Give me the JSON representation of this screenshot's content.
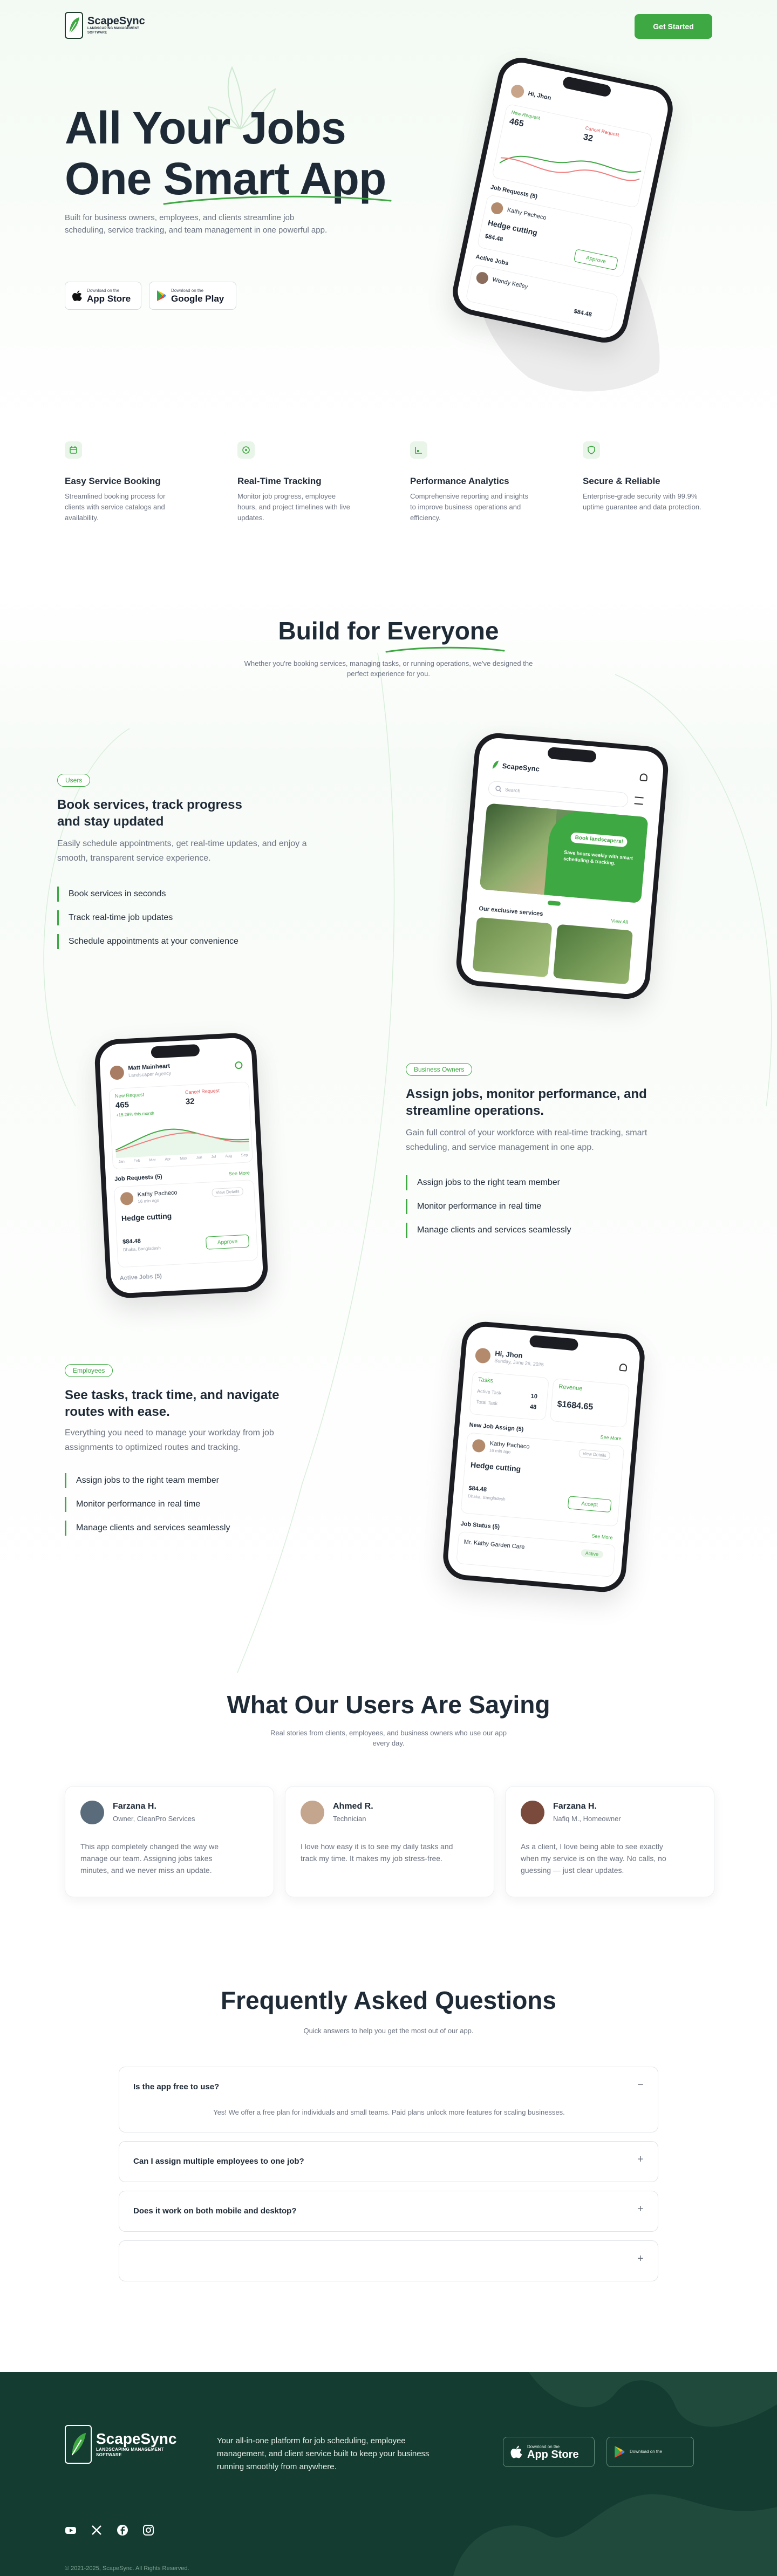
{
  "header": {
    "brand": "ScapeSync",
    "brand_tag": "LANDSCAPING MANAGEMENT SOFTWARE",
    "cta": "Get Started"
  },
  "hero": {
    "title_line1": "All Your Jobs",
    "title_line2_a": "One ",
    "title_line2_b": "Smart App",
    "subtitle": "Built for business owners, employees, and clients streamline job scheduling, service tracking, and team management in one powerful app.",
    "app_store_small": "Download on the",
    "app_store_big": "App Store",
    "google_small": "Download on the",
    "google_big": "Google Play"
  },
  "hero_phone": {
    "greeting": "Hi, Jhon",
    "new_request_label": "New Request",
    "new_request_value": "465",
    "cancel_request_label": "Cancel Request",
    "cancel_request_value": "32",
    "job_requests": "Job Requests (5)",
    "client": "Kathy Pacheco",
    "job": "Hedge cutting",
    "price": "$84.48",
    "approve": "Approve",
    "active_jobs": "Active Jobs",
    "worker": "Wendy Kelley",
    "price2": "$84.48"
  },
  "features": [
    {
      "title": "Easy Service Booking",
      "desc": "Streamlined booking process for clients with service catalogs and availability.",
      "icon": "calendar-icon"
    },
    {
      "title": "Real-Time Tracking",
      "desc": "Monitor job progress, employee hours, and project timelines with live updates.",
      "icon": "target-icon"
    },
    {
      "title": "Performance Analytics",
      "desc": "Comprehensive reporting and insights to improve business operations and efficiency.",
      "icon": "chart-icon"
    },
    {
      "title": "Secure & Reliable",
      "desc": "Enterprise-grade security with 99.9% uptime guarantee and data protection.",
      "icon": "shield-icon"
    }
  ],
  "everyone": {
    "title_a": "Build for ",
    "title_b": "Everyone",
    "subtitle": "Whether you're booking services, managing tasks, or running operations, we've designed the perfect experience for you."
  },
  "users_block": {
    "pill": "Users",
    "title": "Book services, track progress and stay updated",
    "desc": "Easily schedule appointments, get real-time updates, and enjoy a smooth, transparent service experience.",
    "items": [
      "Book services in seconds",
      "Track real-time job updates",
      "Schedule appointments at your convenience"
    ]
  },
  "users_phone": {
    "brand": "ScapeSync",
    "search": "Search",
    "banner_btn": "Book landscapers!",
    "banner_text": "Save hours weekly with smart scheduling & tracking.",
    "exclusive": "Our exclusive services",
    "view_all": "View All"
  },
  "owners_block": {
    "pill": "Business Owners",
    "title": "Assign jobs, monitor performance, and streamline operations.",
    "desc": "Gain full control of your workforce with real-time tracking, smart scheduling, and service management in one app.",
    "items": [
      "Assign jobs to the right team member",
      "Monitor performance in real time",
      "Manage clients and services seamlessly"
    ]
  },
  "owners_phone": {
    "name": "Matt Mainheart",
    "role": "Landscaper Agency",
    "new_request_label": "New Request",
    "new_request_value": "465",
    "cancel_request_label": "Cancel Request",
    "cancel_request_value": "32",
    "growth": "+15.29% this month",
    "months": [
      "Jan",
      "Feb",
      "Mar",
      "Apr",
      "May",
      "Jun",
      "Jul",
      "Aug",
      "Sep"
    ],
    "job_requests": "Job Requests (5)",
    "see_more": "See More",
    "client": "Kathy Pacheco",
    "client_time": "16 min ago",
    "view_details": "View Details",
    "job": "Hedge cutting",
    "price": "$84.48",
    "location": "Dhaka, Bangladesh",
    "approve": "Approve",
    "active_jobs": "Active Jobs (5)"
  },
  "employees_block": {
    "pill": "Employees",
    "title": "See tasks, track time, and navigate routes with ease.",
    "desc": "Everything you need to manage your workday from job assignments to optimized routes and tracking.",
    "items": [
      "Assign jobs to the right team member",
      "Monitor performance in real time",
      "Manage clients and services seamlessly"
    ]
  },
  "employees_phone": {
    "greeting": "Hi, Jhon",
    "date": "Sunday, June 26, 2025",
    "tasks": "Tasks",
    "active_task": "Active Task",
    "active_task_value": "10",
    "total_task": "Total Task",
    "total_task_value": "48",
    "revenue": "Revenue",
    "revenue_value": "$1684.65",
    "new_job": "New Job Assign (5)",
    "see_more": "See More",
    "client": "Kathy Pacheco",
    "client_time": "16 min ago",
    "view_details": "View Details",
    "job": "Hedge cutting",
    "price": "$84.48",
    "location": "Dhaka, Bangladesh",
    "accept": "Accept",
    "job_status": "Job Status (5)",
    "job_status_see": "See More",
    "status_item": "Mr. Kathy Garden Care",
    "status_badge": "Active"
  },
  "testimonials": {
    "title": "What Our Users Are Saying",
    "subtitle": "Real stories from clients, employees, and business owners who use our app every day.",
    "items": [
      {
        "name": "Farzana H.",
        "role": "Owner, CleanPro Services",
        "quote": "This app completely changed the way we manage our team. Assigning jobs takes minutes, and we never miss an update."
      },
      {
        "name": "Ahmed R.",
        "role": "Technician",
        "quote": "I love how easy it is to see my daily tasks and track my time. It makes my job stress-free."
      },
      {
        "name": "Farzana H.",
        "role": "Nafiq M., Homeowner",
        "quote": "As a client, I love being able to see exactly when my service is on the way. No calls, no guessing — just clear updates."
      }
    ]
  },
  "faq": {
    "title": "Frequently Asked Questions",
    "subtitle": "Quick answers to help you get the most out of our app.",
    "items": [
      {
        "q": "Is the app free to use?",
        "a": "Yes! We offer a free plan for individuals and small teams. Paid plans unlock more features for scaling businesses.",
        "open": true
      },
      {
        "q": "Can I assign multiple employees to one job?",
        "a": "",
        "open": false
      },
      {
        "q": "Does it work on both mobile and desktop?",
        "a": "",
        "open": false
      },
      {
        "q": "",
        "a": "",
        "open": false
      }
    ]
  },
  "footer": {
    "brand": "ScapeSync",
    "brand_tag": "LANDSCAPING MANAGEMENT SOFTWARE",
    "desc": "Your all-in-one platform for job scheduling, employee management, and client service built to keep your business running smoothly from anywhere.",
    "app_store_small": "Download on the",
    "app_store_big": "App Store",
    "google_small": "Download on the",
    "copyright": "© 2021-2025, ScapeSync. All Rights Reserved.",
    "socials": [
      "youtube-icon",
      "x-icon",
      "facebook-icon",
      "instagram-icon"
    ]
  },
  "colors": {
    "accent": "#3ea842",
    "footer": "#153c31",
    "text": "#1f2a37"
  }
}
